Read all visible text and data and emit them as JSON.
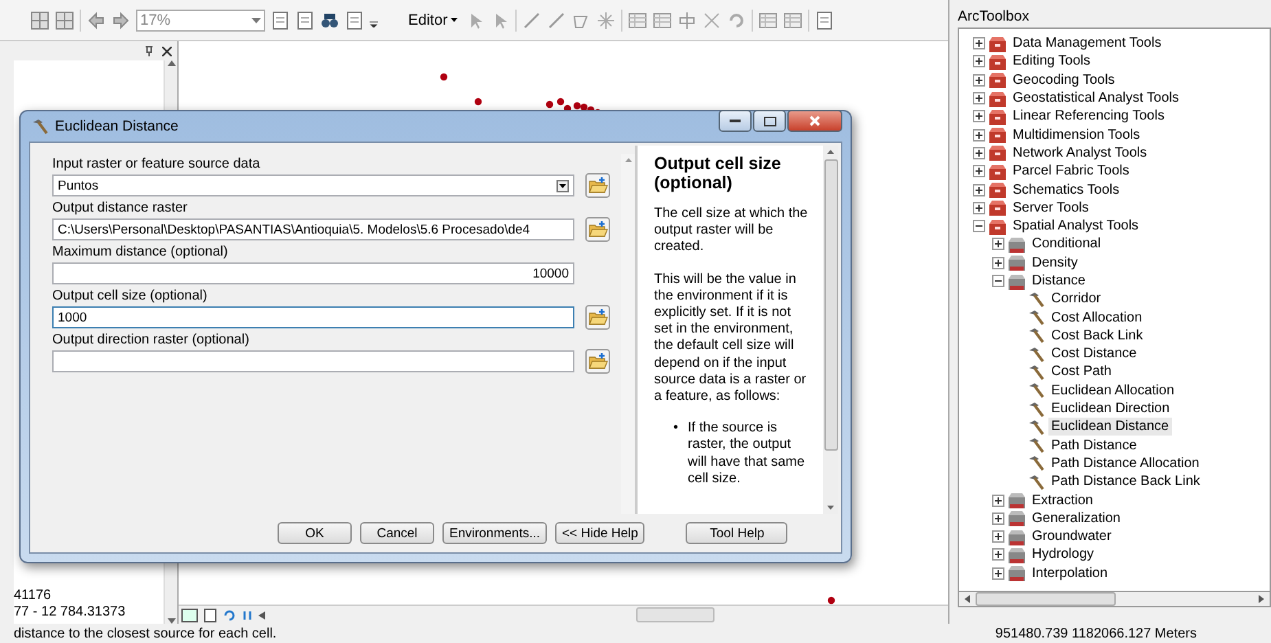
{
  "toolbar": {
    "zoom": "17%",
    "editor_menu": "Editor"
  },
  "table_of_contents": {
    "lines": [
      "41176",
      "77 - 12 784.31373"
    ]
  },
  "dialog": {
    "title": "Euclidean Distance",
    "fields": [
      {
        "label": "Input raster or feature source data",
        "kind": "dropdown",
        "value": "Puntos",
        "browse": true,
        "focused": false
      },
      {
        "label": "Output distance raster",
        "kind": "text",
        "value": "C:\\Users\\Personal\\Desktop\\PASANTIAS\\Antioquia\\5. Modelos\\5.6 Procesado\\de4",
        "browse": true,
        "focused": false
      },
      {
        "label": "Maximum distance (optional)",
        "kind": "number",
        "value": "10000",
        "browse": false,
        "focused": false
      },
      {
        "label": "Output cell size (optional)",
        "kind": "text",
        "value": "1000",
        "browse": true,
        "focused": true
      },
      {
        "label": "Output direction raster (optional)",
        "kind": "text",
        "browse": true,
        "focused": false
      }
    ],
    "buttons": [
      "OK",
      "Cancel",
      "Environments...",
      "<< Hide Help"
    ],
    "help": {
      "title": "Output cell size (optional)",
      "paragraphs": [
        "The cell size at which the output raster will be created.",
        "This will be the value in the environment if it is explicitly set. If it is not set in the environment, the default cell size will depend on if the input source data is a raster or a feature, as follows:"
      ],
      "bullets": [
        {
          "marker": "•",
          "text": "If the source is raster, the output will have that same cell size."
        }
      ]
    },
    "help_button": "Tool Help"
  },
  "toolbox": {
    "title": "ArcToolbox",
    "tree": [
      {
        "label": "Data Management Tools",
        "kind": "toolbox",
        "expanded": false,
        "selected": false
      },
      {
        "label": "Editing Tools",
        "kind": "toolbox",
        "expanded": false,
        "selected": false
      },
      {
        "label": "Geocoding Tools",
        "kind": "toolbox",
        "expanded": false,
        "selected": false
      },
      {
        "label": "Geostatistical Analyst Tools",
        "kind": "toolbox",
        "expanded": false,
        "selected": false
      },
      {
        "label": "Linear Referencing Tools",
        "kind": "toolbox",
        "expanded": false,
        "selected": false
      },
      {
        "label": "Multidimension Tools",
        "kind": "toolbox",
        "expanded": false,
        "selected": false
      },
      {
        "label": "Network Analyst Tools",
        "kind": "toolbox",
        "expanded": false,
        "selected": false
      },
      {
        "label": "Parcel Fabric Tools",
        "kind": "toolbox",
        "expanded": false,
        "selected": false
      },
      {
        "label": "Schematics Tools",
        "kind": "toolbox",
        "expanded": false,
        "selected": false
      },
      {
        "label": "Server Tools",
        "kind": "toolbox",
        "expanded": false,
        "selected": false
      },
      {
        "label": "Spatial Analyst Tools",
        "kind": "toolbox",
        "expanded": true,
        "selected": false,
        "children": [
          {
            "label": "Conditional",
            "kind": "toolset",
            "expanded": false,
            "selected": false
          },
          {
            "label": "Density",
            "kind": "toolset",
            "expanded": false,
            "selected": false
          },
          {
            "label": "Distance",
            "kind": "toolset",
            "expanded": true,
            "selected": false,
            "children": [
              {
                "label": "Corridor",
                "kind": "tool",
                "selected": false
              },
              {
                "label": "Cost Allocation",
                "kind": "tool",
                "selected": false
              },
              {
                "label": "Cost Back Link",
                "kind": "tool",
                "selected": false
              },
              {
                "label": "Cost Distance",
                "kind": "tool",
                "selected": false
              },
              {
                "label": "Cost Path",
                "kind": "tool",
                "selected": false
              },
              {
                "label": "Euclidean Allocation",
                "kind": "tool",
                "selected": false
              },
              {
                "label": "Euclidean Direction",
                "kind": "tool",
                "selected": false
              },
              {
                "label": "Euclidean Distance",
                "kind": "tool",
                "selected": true
              },
              {
                "label": "Path Distance",
                "kind": "tool",
                "selected": false
              },
              {
                "label": "Path Distance Allocation",
                "kind": "tool",
                "selected": false
              },
              {
                "label": "Path Distance Back Link",
                "kind": "tool",
                "selected": false
              }
            ]
          },
          {
            "label": "Extraction",
            "kind": "toolset",
            "expanded": false,
            "selected": false
          },
          {
            "label": "Generalization",
            "kind": "toolset",
            "expanded": false,
            "selected": false
          },
          {
            "label": "Groundwater",
            "kind": "toolset",
            "expanded": false,
            "selected": false
          },
          {
            "label": "Hydrology",
            "kind": "toolset",
            "expanded": false,
            "selected": false
          },
          {
            "label": "Interpolation",
            "kind": "toolset",
            "expanded": false,
            "selected": false
          }
        ]
      }
    ]
  },
  "status_bar": {
    "message": "distance to the closest source for each cell.",
    "coordinates": "951480.739  1182066.127 Meters"
  }
}
